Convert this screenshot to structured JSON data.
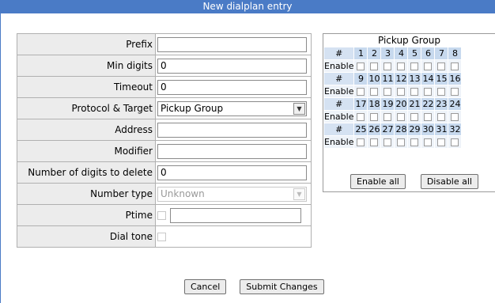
{
  "window": {
    "title": "New dialplan entry"
  },
  "form": {
    "prefix": {
      "label": "Prefix",
      "value": ""
    },
    "min_digits": {
      "label": "Min digits",
      "value": "0"
    },
    "timeout": {
      "label": "Timeout",
      "value": "0"
    },
    "protocol_target": {
      "label": "Protocol & Target",
      "value": "Pickup Group"
    },
    "address": {
      "label": "Address",
      "value": ""
    },
    "modifier": {
      "label": "Modifier",
      "value": ""
    },
    "digits_to_delete": {
      "label": "Number of digits to delete",
      "value": "0"
    },
    "number_type": {
      "label": "Number type",
      "value": "Unknown"
    },
    "ptime": {
      "label": "Ptime",
      "value": ""
    },
    "dial_tone": {
      "label": "Dial tone"
    }
  },
  "pickup": {
    "title": "Pickup Group",
    "hash_label": "#",
    "enable_label": "Enable",
    "rows": [
      [
        "1",
        "2",
        "3",
        "4",
        "5",
        "6",
        "7",
        "8"
      ],
      [
        "9",
        "10",
        "11",
        "12",
        "13",
        "14",
        "15",
        "16"
      ],
      [
        "17",
        "18",
        "19",
        "20",
        "21",
        "22",
        "23",
        "24"
      ],
      [
        "25",
        "26",
        "27",
        "28",
        "29",
        "30",
        "31",
        "32"
      ]
    ],
    "enable_all": "Enable all",
    "disable_all": "Disable all"
  },
  "buttons": {
    "cancel": "Cancel",
    "submit": "Submit Changes"
  },
  "colors": {
    "titlebar": "#4a7bc6",
    "label_bg": "#ececec",
    "grid_bg": "#d5e2f2"
  }
}
